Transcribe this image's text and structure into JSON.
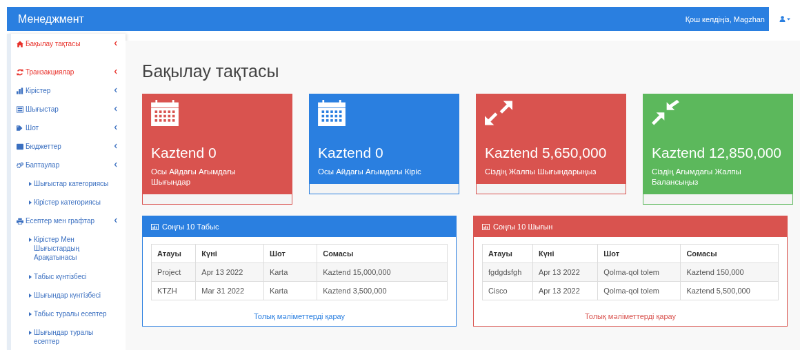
{
  "header": {
    "brand": "Менеджмент",
    "welcome": "Қош келдіңіз, Magzhan"
  },
  "sidebar": {
    "items": [
      {
        "kind": "section",
        "label": "Бақылау тақтасы",
        "selected": true
      },
      {
        "kind": "section",
        "label": "Транзакциялар",
        "selected": true
      },
      {
        "kind": "section",
        "label": "Кірістер",
        "selected": false
      },
      {
        "kind": "section",
        "label": "Шығыстар",
        "selected": false
      },
      {
        "kind": "section",
        "label": "Шот",
        "selected": false
      },
      {
        "kind": "section",
        "label": "Бюджеттер",
        "selected": false
      },
      {
        "kind": "section",
        "label": "Баптаулар",
        "selected": false
      },
      {
        "kind": "sub",
        "label": "Шығыстар категориясы",
        "selected": false
      },
      {
        "kind": "sub",
        "label": "Кірістер категориясы",
        "selected": false
      },
      {
        "kind": "section",
        "label": "Есептер мен графтар",
        "selected": false
      },
      {
        "kind": "sub",
        "label": "Кірістер Мен Шығыстардың Арақатынасы",
        "selected": false
      },
      {
        "kind": "sub",
        "label": "Табыс күнтізбесі",
        "selected": false
      },
      {
        "kind": "sub",
        "label": "Шығындар күнтізбесі",
        "selected": false
      },
      {
        "kind": "sub",
        "label": "Табыс туралы есептер",
        "selected": false
      },
      {
        "kind": "sub",
        "label": "Шығындар туралы есептер",
        "selected": false
      }
    ]
  },
  "page_title": "Бақылау тақтасы",
  "cards": [
    {
      "value": "Kaztend 0",
      "label": "Осы Айдағы Ағымдағы Шығындар",
      "color": "#d9534f"
    },
    {
      "value": "Kaztend 0",
      "label": "Осы Айдағы Ағымдағы Кіріс",
      "color": "#2a7fe0"
    },
    {
      "value": "Kaztend 5,650,000",
      "label": "Сіздің Жалпы Шығындарыңыз",
      "color": "#d9534f"
    },
    {
      "value": "Kaztend 12,850,000",
      "label": "Сіздің Ағымдағы Жалпы Балансыңыз",
      "color": "#5cb85c"
    }
  ],
  "panels": [
    {
      "title": "Соңғы 10 Табыс",
      "color": "#2a7fe0",
      "columns": [
        "Атауы",
        "Күні",
        "Шот",
        "Сомасы"
      ],
      "rows": [
        [
          "Project",
          "Apr 13 2022",
          "Karta",
          "Kaztend 15,000,000"
        ],
        [
          "KTZH",
          "Mar 31 2022",
          "Karta",
          "Kaztend 3,500,000"
        ]
      ],
      "link": "Толық мәліметтерді қарау"
    },
    {
      "title": "Соңғы 10 Шығын",
      "color": "#d9534f",
      "columns": [
        "Атауы",
        "Күні",
        "Шот",
        "Сомасы"
      ],
      "rows": [
        [
          "fgdgdsfgh",
          "Apr 13 2022",
          "Qolma-qol tolem",
          "Kaztend 150,000"
        ],
        [
          "Cisco",
          "Apr 13 2022",
          "Qolma-qol tolem",
          "Kaztend 5,500,000"
        ]
      ],
      "link": "Толық мәліметтерді қарау"
    }
  ]
}
